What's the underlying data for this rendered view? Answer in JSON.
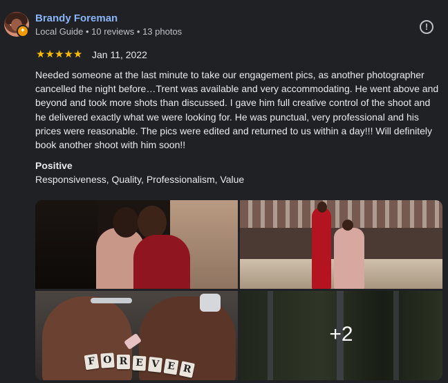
{
  "reviewer": {
    "name": "Brandy Foreman",
    "meta": "Local Guide • 10 reviews • 13 photos"
  },
  "rating": {
    "stars": 5,
    "star_glyph": "★",
    "date": "Jan 11, 2022"
  },
  "review_text": "Needed someone at the last minute to take our engagement pics, as another photographer cancelled the night before…Trent was available and very accommodating. He went above and beyond and took more shots than discussed. I gave him full creative control of the shoot and he delivered exactly what we were looking for. He was punctual, very professional and his prices were reasonable. The pics were edited and returned to us within a day!!! Will definitely book another shoot with him soon!!",
  "positive": {
    "title": "Positive",
    "values": "Responsiveness, Quality, Professionalism, Value"
  },
  "photos": {
    "more_label": "+2",
    "scrabble_tiles": [
      "F",
      "O",
      "R",
      "E",
      "V",
      "E",
      "R"
    ]
  },
  "icons": {
    "report": "!",
    "guide_badge": "✦"
  },
  "colors": {
    "background": "#202124",
    "name_link": "#8ab4f8",
    "star": "#fbbc04",
    "text": "#e8eaed",
    "muted": "#bdc1c6"
  }
}
